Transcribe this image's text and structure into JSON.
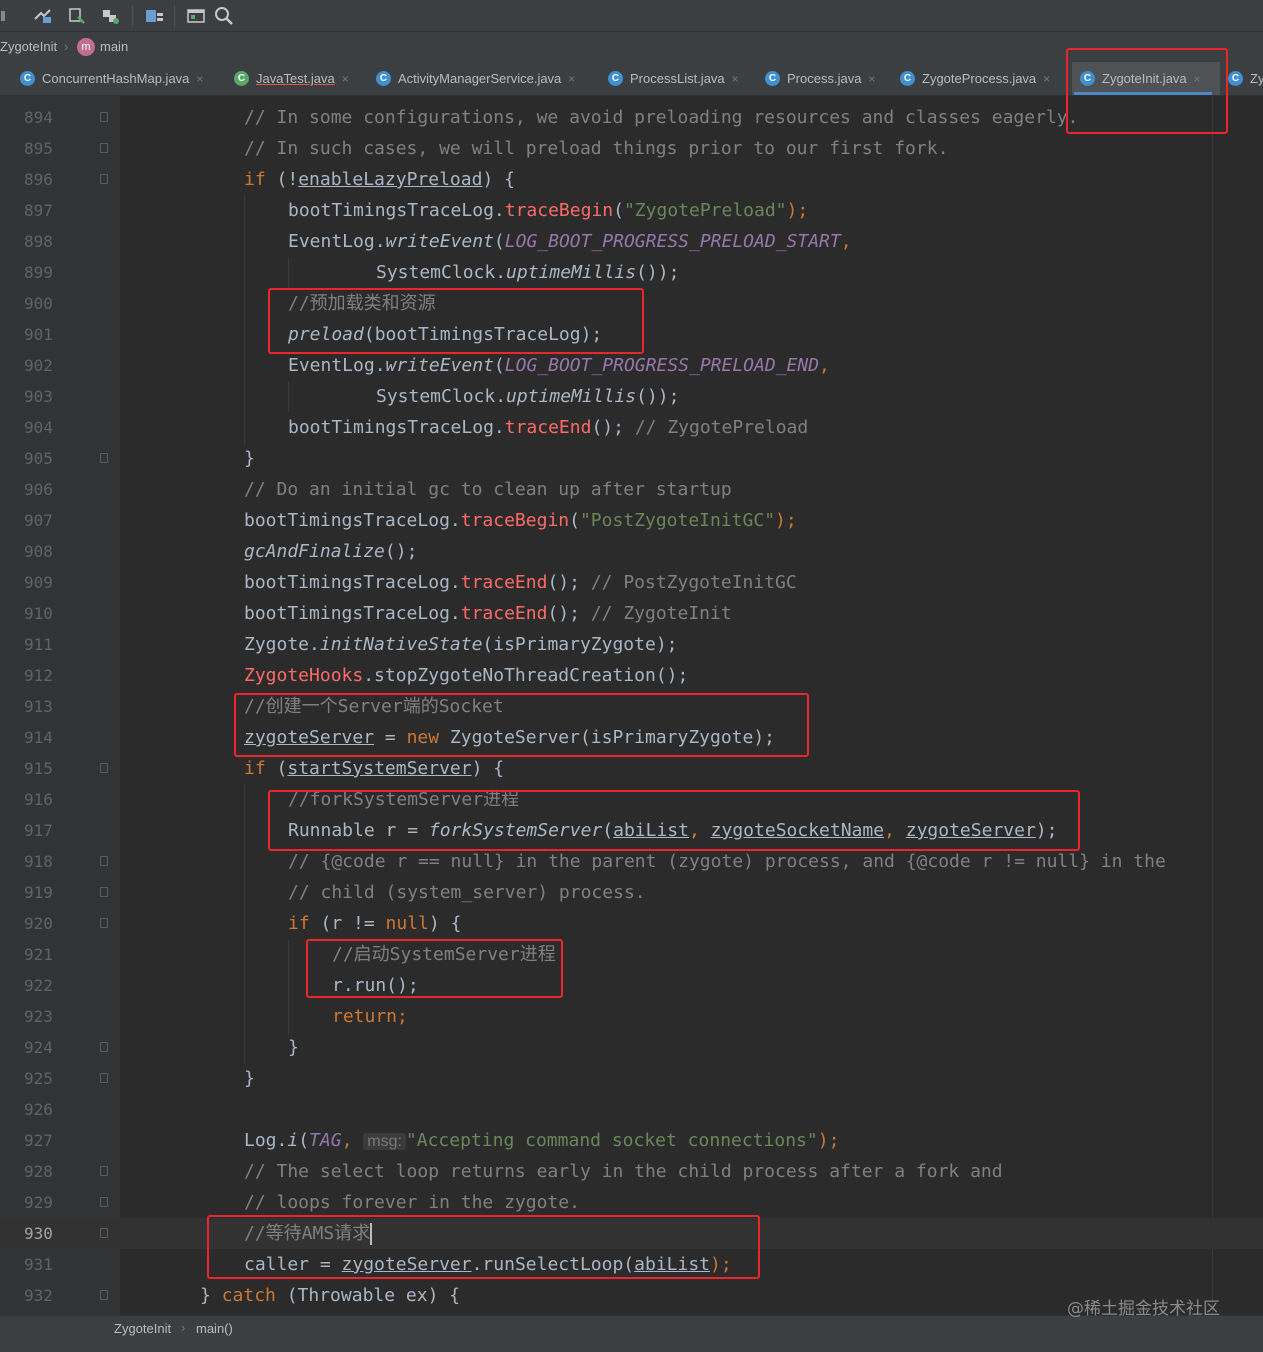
{
  "toolbar": {
    "icons": [
      "build-icon",
      "run-target-icon",
      "deploy-icon",
      "project-structure-icon",
      "window-icon",
      "search-icon"
    ]
  },
  "breadcrumb": {
    "class": "ZygoteInit",
    "method_badge": "m",
    "method": "main"
  },
  "tabs": [
    {
      "label": "ConcurrentHashMap.java",
      "icon": "C"
    },
    {
      "label": "JavaTest.java",
      "icon": "C"
    },
    {
      "label": "ActivityManagerService.java",
      "icon": "C"
    },
    {
      "label": "ProcessList.java",
      "icon": "C"
    },
    {
      "label": "Process.java",
      "icon": "C"
    },
    {
      "label": "ZygoteProcess.java",
      "icon": "C"
    },
    {
      "label": "ZygoteInit.java",
      "icon": "C"
    },
    {
      "label": "Zy",
      "icon": "C"
    }
  ],
  "close_glyph": "×",
  "line_numbers": [
    "894",
    "895",
    "896",
    "897",
    "898",
    "899",
    "900",
    "901",
    "902",
    "903",
    "904",
    "905",
    "906",
    "907",
    "908",
    "909",
    "910",
    "911",
    "912",
    "913",
    "914",
    "915",
    "916",
    "917",
    "918",
    "919",
    "920",
    "921",
    "922",
    "923",
    "924",
    "925",
    "926",
    "927",
    "928",
    "929",
    "930",
    "931",
    "932"
  ],
  "code": {
    "l894": "// In some configurations, we avoid preloading resources and classes eagerly.",
    "l895": "// In such cases, we will preload things prior to our first fork.",
    "l896_a": "if",
    "l896_b": " (!",
    "l896_c": "enableLazyPreload",
    "l896_d": ") {",
    "l897_a": "bootTimingsTraceLog.",
    "l897_b": "traceBegin",
    "l897_c": "(",
    "l897_d": "\"ZygotePreload\"",
    "l897_e": ");",
    "l898_a": "EventLog.",
    "l898_b": "writeEvent",
    "l898_c": "(",
    "l898_d": "LOG_BOOT_PROGRESS_PRELOAD_START",
    "l898_e": ",",
    "l899_a": "SystemClock.",
    "l899_b": "uptimeMillis",
    "l899_c": "());",
    "l900": "//预加载类和资源",
    "l901_a": "preload",
    "l901_b": "(bootTimingsTraceLog);",
    "l902_a": "EventLog.",
    "l902_b": "writeEvent",
    "l902_c": "(",
    "l902_d": "LOG_BOOT_PROGRESS_PRELOAD_END",
    "l902_e": ",",
    "l903_a": "SystemClock.",
    "l903_b": "uptimeMillis",
    "l903_c": "());",
    "l904_a": "bootTimingsTraceLog.",
    "l904_b": "traceEnd",
    "l904_c": "(); ",
    "l904_d": "// ZygotePreload",
    "l905": "}",
    "l906": "// Do an initial gc to clean up after startup",
    "l907_a": "bootTimingsTraceLog.",
    "l907_b": "traceBegin",
    "l907_c": "(",
    "l907_d": "\"PostZygoteInitGC\"",
    "l907_e": ");",
    "l908_a": "gcAndFinalize",
    "l908_b": "();",
    "l909_a": "bootTimingsTraceLog.",
    "l909_b": "traceEnd",
    "l909_c": "(); ",
    "l909_d": "// PostZygoteInitGC",
    "l910_a": "bootTimingsTraceLog.",
    "l910_b": "traceEnd",
    "l910_c": "(); ",
    "l910_d": "// ZygoteInit",
    "l911_a": "Zygote.",
    "l911_b": "initNativeState",
    "l911_c": "(isPrimaryZygote);",
    "l912_a": "ZygoteHooks",
    "l912_b": ".stopZygoteNoThreadCreation();",
    "l913": "//创建一个Server端的Socket",
    "l914_a": "zygoteServer",
    "l914_b": " = ",
    "l914_c": "new",
    "l914_d": " ZygoteServer(isPrimaryZygote);",
    "l915_a": "if",
    "l915_b": " (",
    "l915_c": "startSystemServer",
    "l915_d": ") {",
    "l916": "//forkSystemServer进程",
    "l917_a": "Runnable r = ",
    "l917_b": "forkSystemServer",
    "l917_c": "(",
    "l917_d": "abiList",
    "l917_e": ", ",
    "l917_f": "zygoteSocketName",
    "l917_g": ", ",
    "l917_h": "zygoteServer",
    "l917_i": ");",
    "l918": "// {@code r == null} in the parent (zygote) process, and {@code r != null} in the",
    "l919": "// child (system_server) process.",
    "l920_a": "if",
    "l920_b": " (r != ",
    "l920_c": "null",
    "l920_d": ") {",
    "l921": "//启动SystemServer进程",
    "l922": "r.run();",
    "l923": "return;",
    "l924": "}",
    "l925": "}",
    "l927_a": "Log.",
    "l927_b": "i",
    "l927_c": "(",
    "l927_d": "TAG",
    "l927_e": ", ",
    "l927_hint": "msg:",
    "l927_f": "\"Accepting command socket connections\"",
    "l927_g": ");",
    "l928": "// The select loop returns early in the child process after a fork and",
    "l929": "// loops forever in the zygote.",
    "l930": "//等待AMS请求",
    "l931_a": "caller = ",
    "l931_b": "zygoteServer",
    "l931_c": ".runSelectLoop(",
    "l931_d": "abiList",
    "l931_e": ");",
    "l932_a": "} ",
    "l932_b": "catch",
    "l932_c": " (Throwable ex) {"
  },
  "statusbar": {
    "class": "ZygoteInit",
    "method": "main()"
  },
  "watermark": "@稀土掘金技术社区",
  "colors": {
    "background": "#2b2b2b",
    "keyword": "#cc7832",
    "comment": "#808080",
    "string": "#6a8759",
    "method_call": "#ff6b68",
    "constant": "#9876aa",
    "annotation_box": "#e8262c",
    "tab_underline": "#4a88c7"
  }
}
